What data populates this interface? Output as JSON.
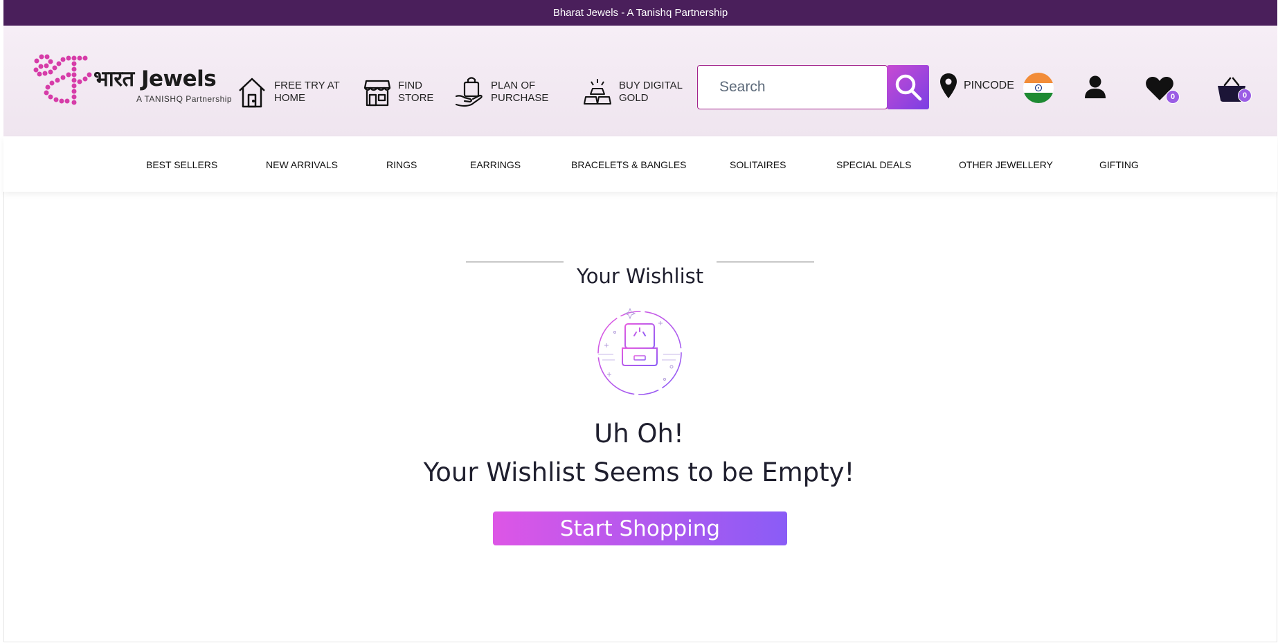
{
  "announcement": "Bharat Jewels - A Tanishq Partnership",
  "brand": {
    "name": "भारत Jewels",
    "tagline": "A TANISHQ Partnership"
  },
  "header_links": [
    {
      "label": "FREE TRY AT HOME",
      "icon": "house-icon"
    },
    {
      "label": "FIND STORE",
      "icon": "store-icon"
    },
    {
      "label": "PLAN OF PURCHASE",
      "icon": "shopping-bag-hand-icon"
    },
    {
      "label": "BUY DIGITAL GOLD",
      "icon": "gold-bars-icon"
    }
  ],
  "search": {
    "placeholder": "Search"
  },
  "pincode_label": "PINCODE",
  "wishlist_count": "0",
  "cart_count": "0",
  "nav": [
    "BEST SELLERS",
    "NEW ARRIVALS",
    "RINGS",
    "EARRINGS",
    "BRACELETS & BANGLES",
    "SOLITAIRES",
    "SPECIAL DEALS",
    "OTHER JEWELLERY",
    "GIFTING"
  ],
  "wishlist": {
    "title": "Your Wishlist",
    "message_line1": "Uh Oh!",
    "message_line2": "Your Wishlist Seems to be Empty!",
    "cta": "Start Shopping"
  },
  "colors": {
    "topbar": "#4a1f5b",
    "brand_pink": "#d63ca8",
    "accent_purple": "#8a5cf6"
  }
}
